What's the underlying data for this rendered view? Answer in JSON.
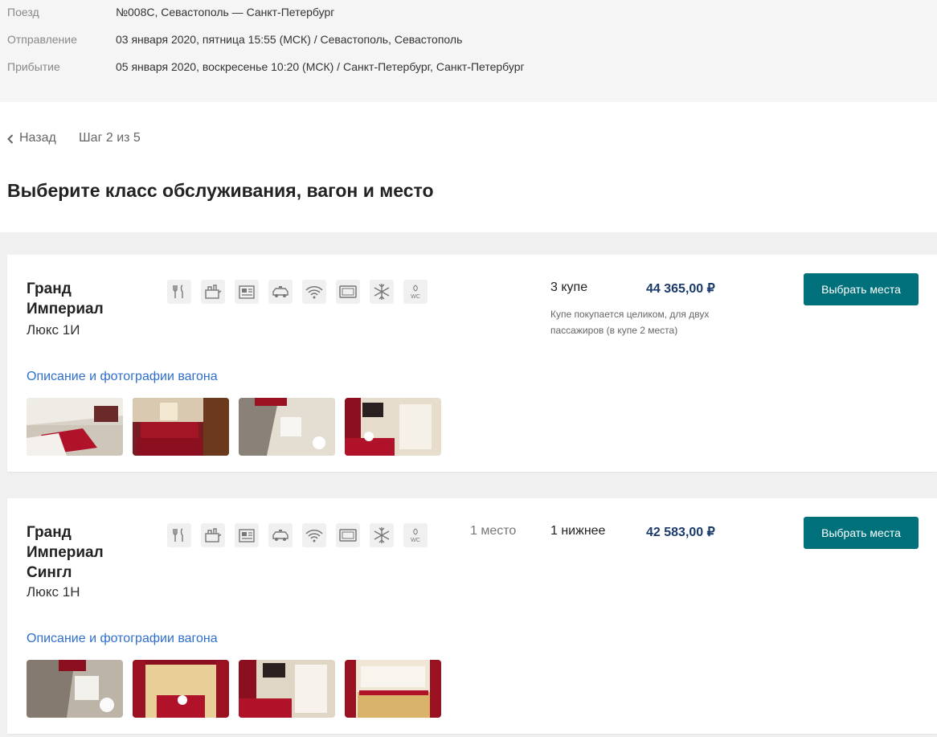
{
  "trip": {
    "train_label": "Поезд",
    "train_value": "№008С, Севастополь — Санкт-Петербург",
    "departure_label": "Отправление",
    "departure_value": "03 января 2020, пятница 15:55 (МСК) / Севастополь, Севастополь",
    "arrival_label": "Прибытие",
    "arrival_value": "05 января 2020, воскресенье 10:20 (МСК) / Санкт-Петербург, Санкт-Петербург"
  },
  "nav": {
    "back_label": "Назад",
    "step_label": "Шаг 2 из 5"
  },
  "page_title": "Выберите класс обслуживания, вагон и место",
  "colors": {
    "accent": "#00707a",
    "price": "#1a3a6b",
    "link": "#2f6fcb",
    "info_bg": "#f5f5f5"
  },
  "amenity_icons": [
    "restaurant-icon",
    "hygiene-kit-icon",
    "press-icon",
    "taxi-icon",
    "wifi-icon",
    "tv-icon",
    "air-conditioning-icon",
    "wc-icon"
  ],
  "amenity_wc_text": "WC",
  "cars": [
    {
      "name": "Гранд Империал",
      "class": "Люкс 1И",
      "seat_count": "",
      "compartment": "3 купе",
      "price": "44 365,00 ₽",
      "note": "Купе покупается целиком, для двух пассажиров (в купе 2 места)",
      "button_label": "Выбрать места",
      "description_link": "Описание и фотографии вагона"
    },
    {
      "name": "Гранд Империал Сингл",
      "class": "Люкс 1Н",
      "seat_count": "1 место",
      "compartment": "1 нижнее",
      "price": "42 583,00 ₽",
      "note": "",
      "button_label": "Выбрать места",
      "description_link": "Описание и фотографии вагона"
    }
  ]
}
